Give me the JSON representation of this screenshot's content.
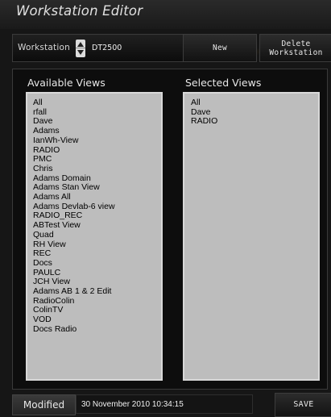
{
  "window": {
    "title": "Workstation Editor"
  },
  "toolbar": {
    "workstation_label": "Workstation",
    "workstation_value": "DT2500",
    "new_label": "New Workstation",
    "delete_label": "Delete\nWorkstation"
  },
  "available_views": {
    "title": "Available Views",
    "items": [
      "All",
      "rfall",
      "Dave",
      "Adams",
      "IanWh-View",
      "RADIO",
      "PMC",
      "Chris",
      "Adams Domain",
      "Adams Stan View",
      "Adams All",
      "Adams Devlab-6 view",
      "RADIO_REC",
      "ABTest View",
      "Quad",
      "RH View",
      "REC",
      "Docs",
      "PAULC",
      "JCH View",
      "Adams AB 1 & 2 Edit",
      "RadioColin",
      "ColinTV",
      "VOD",
      "Docs Radio"
    ]
  },
  "selected_views": {
    "title": "Selected Views",
    "items": [
      "All",
      "Dave",
      "RADIO"
    ]
  },
  "footer": {
    "modified_label": "Modified",
    "modified_value": "30 November 2010 10:34:15",
    "save_label": "SAVE"
  }
}
